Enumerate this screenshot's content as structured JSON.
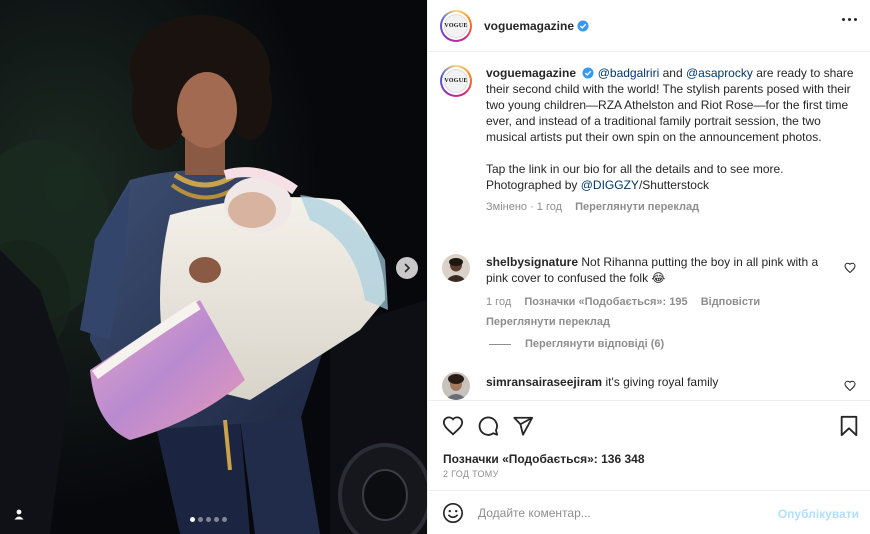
{
  "post": {
    "author": "voguemagazine",
    "avatar_text": "VOGUE",
    "more_icon": "more-horizontal-icon"
  },
  "caption": {
    "author": "voguemagazine",
    "mention1": "@badgalriri",
    "and": "and",
    "mention2": "@asaprocky",
    "text1": "are ready to share their second child with the world! The stylish parents posed with their two young children—RZA Athelston and Riot Rose—for the first time ever, and instead of a traditional family portrait session, the two musical artists put their own spin on the announcement photos.",
    "text2": "Tap the link in our bio for all the details and to see more. Photographed by",
    "mention3": "@DIGGZY",
    "text3": "/Shutterstock",
    "edited": "Змінено · 1 год",
    "translate": "Переглянути переклад"
  },
  "comments": [
    {
      "user": "shelbysignature",
      "text": "Not Rihanna putting the boy in all pink with a pink cover to confused the folk 😂",
      "time": "1 год",
      "likes": "Позначки «Подобається»: 195",
      "reply": "Відповісти",
      "translate": "Переглянути переклад",
      "view_replies": "Переглянути відповіді (6)"
    },
    {
      "user": "simransairaseejiram",
      "text": "it's giving royal family"
    }
  ],
  "footer": {
    "likes": "Позначки «Подобається»: 136 348",
    "time": "2 год тому",
    "placeholder": "Додайте коментар...",
    "publish": "Опублікувати"
  },
  "carousel": {
    "total_slides": 5,
    "active_slide": 1
  },
  "colors": {
    "link": "#00376b",
    "verified": "#3897f0",
    "publish_disabled": "#b2dffc",
    "muted": "#8e8e8e"
  }
}
